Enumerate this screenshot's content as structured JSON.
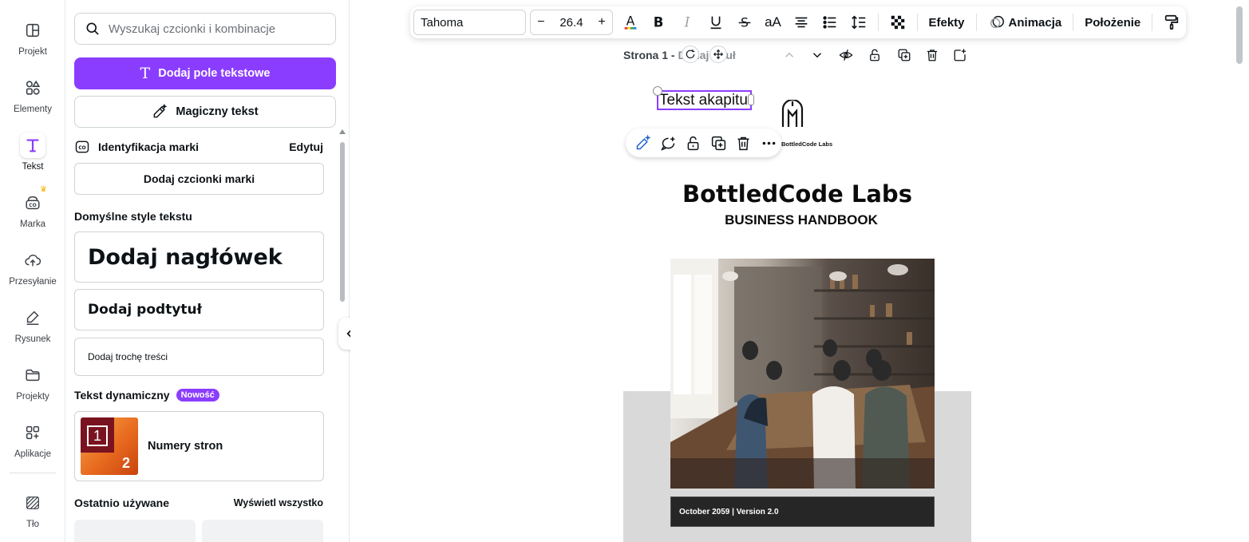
{
  "rail": {
    "items": [
      {
        "label": "Projekt",
        "icon": "layout-icon"
      },
      {
        "label": "Elementy",
        "icon": "shapes-icon"
      },
      {
        "label": "Tekst",
        "icon": "text-icon",
        "active": true
      },
      {
        "label": "Marka",
        "icon": "brand-icon",
        "premium": true
      },
      {
        "label": "Przesyłanie",
        "icon": "upload-cloud-icon"
      },
      {
        "label": "Rysunek",
        "icon": "draw-pen-icon"
      },
      {
        "label": "Projekty",
        "icon": "folder-icon"
      },
      {
        "label": "Aplikacje",
        "icon": "apps-icon"
      },
      {
        "label": "Tło",
        "icon": "background-icon"
      }
    ]
  },
  "panel": {
    "search_placeholder": "Wyszukaj czcionki i kombinacje",
    "add_textbox_label": "Dodaj pole tekstowe",
    "magic_text_label": "Magiczny tekst",
    "brand_kit_label": "Identyfikacja marki",
    "brand_kit_edit": "Edytuj",
    "add_brand_fonts_label": "Dodaj czcionki marki",
    "default_styles_title": "Domyślne style tekstu",
    "heading_label": "Dodaj nagłówek",
    "subheading_label": "Dodaj podtytuł",
    "body_label": "Dodaj trochę treści",
    "dynamic_text_title": "Tekst dynamiczny",
    "new_badge": "Nowość",
    "page_numbers_label": "Numery stron",
    "page_numbers_thumb_1": "1",
    "page_numbers_thumb_2": "2",
    "recent_title": "Ostatnio używane",
    "see_all_label": "Wyświetl wszystko"
  },
  "toolbar": {
    "font_family": "Tahoma",
    "font_size": "26.4",
    "decrease": "−",
    "increase": "+",
    "effects_label": "Efekty",
    "animate_label": "Animacja",
    "position_label": "Położenie",
    "case_label": "aA"
  },
  "page_header": {
    "title_prefix": "Strona 1 - ",
    "title_placeholder": "Dodaj tytuł"
  },
  "document": {
    "selected_text": "Tekst akapitu",
    "logo_text": "BottledCode Labs",
    "title": "BottledCode Labs",
    "subtitle": "BUSINESS HANDBOOK",
    "version": "October 2059 | Version 2.0"
  },
  "colors": {
    "accent": "#8b3dff",
    "page_grey": "#d9d9d9",
    "version_bar": "#262626"
  }
}
